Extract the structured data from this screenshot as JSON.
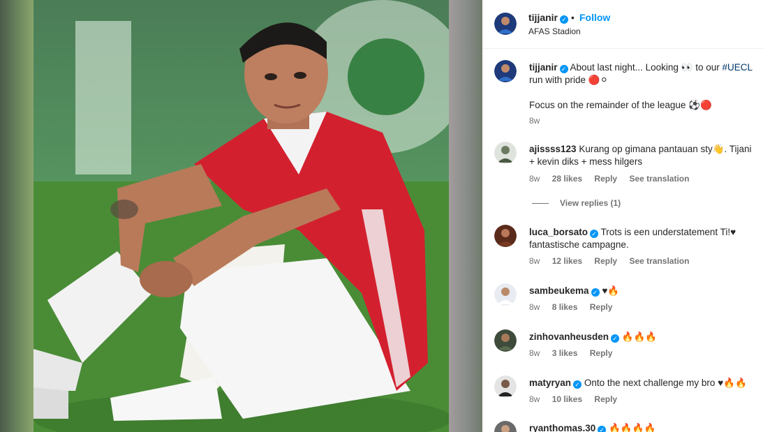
{
  "post": {
    "author": "tijjanir",
    "follow_label": "Follow",
    "location": "AFAS Stadion",
    "separator": "•"
  },
  "caption": {
    "username": "tijjanir",
    "text_1": "About last night... Looking 👀 to our",
    "hashtag": "#UECL",
    "text_2": "run with pride 🔴⚪",
    "text_3": "Focus on the remainder of the league ⚽🔴",
    "time": "8w"
  },
  "comments": [
    {
      "username": "ajissss123",
      "verified": false,
      "text": "Kurang op gimana pantauan sty👋. Tijani + kevin diks + mess hilgers",
      "time": "8w",
      "likes": "28 likes",
      "reply": "Reply",
      "translate": "See translation"
    },
    {
      "username": "luca_borsato",
      "verified": true,
      "text": "Trots is een understatement Ti!♥ fantastische campagne.",
      "time": "8w",
      "likes": "12 likes",
      "reply": "Reply",
      "translate": "See translation"
    },
    {
      "username": "sambeukema",
      "verified": true,
      "text": "♥🔥",
      "time": "8w",
      "likes": "8 likes",
      "reply": "Reply"
    },
    {
      "username": "zinhovanheusden",
      "verified": true,
      "text": "🔥🔥🔥",
      "time": "8w",
      "likes": "3 likes",
      "reply": "Reply"
    },
    {
      "username": "matyryan",
      "verified": true,
      "text": "Onto the next challenge my bro ♥🔥🔥",
      "time": "8w",
      "likes": "10 likes",
      "reply": "Reply"
    },
    {
      "username": "ryanthomas.30",
      "verified": true,
      "text": "🔥🔥🔥🔥"
    }
  ],
  "view_replies_label": "View replies (1)",
  "icons": {
    "verified": "verified-badge-icon",
    "next": "chevron-right-icon"
  },
  "colors": {
    "link": "#0095f6",
    "hashtag": "#00376b",
    "muted": "#737373",
    "jersey": "#d3202f"
  }
}
